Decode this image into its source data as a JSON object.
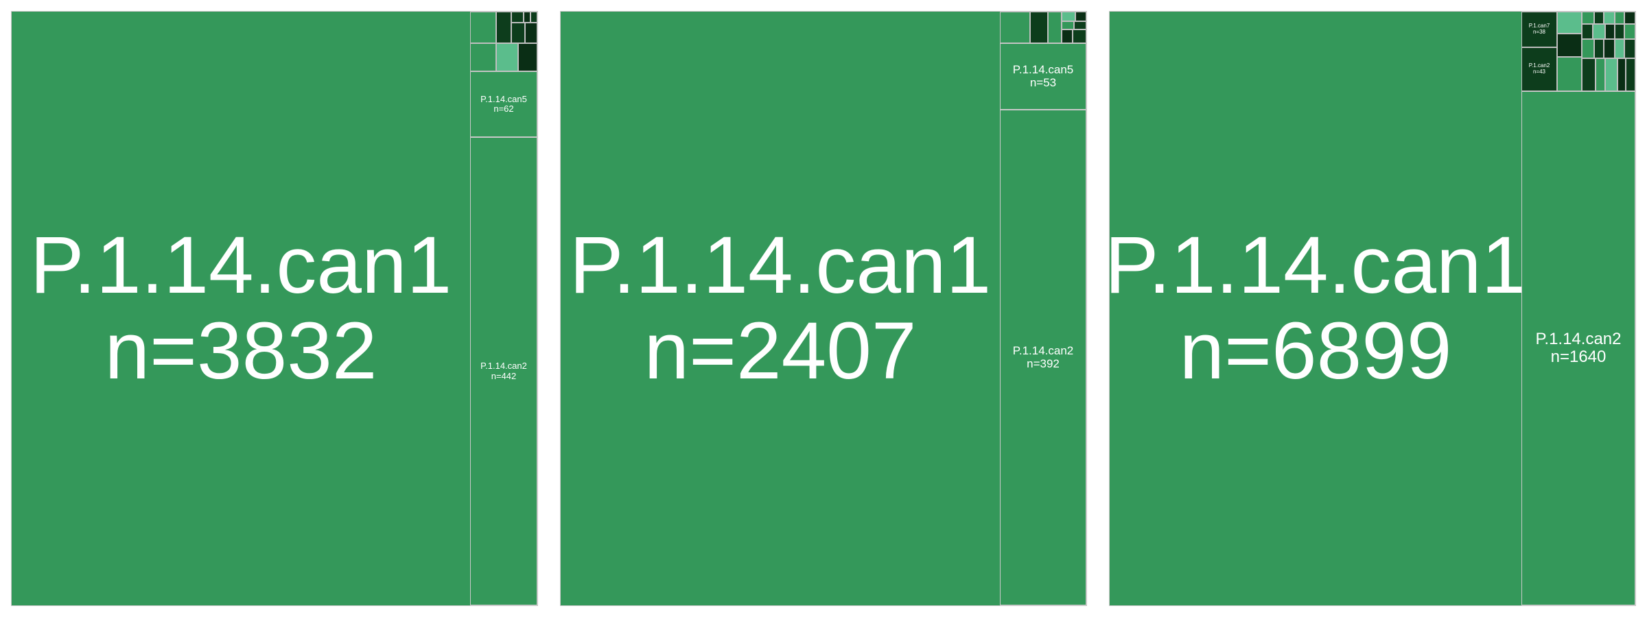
{
  "chart_data": [
    {
      "type": "treemap",
      "cells": [
        {
          "name": "P.1.14.can1",
          "n_label": "n=3832",
          "value": 3832
        },
        {
          "name": "P.1.14.can2",
          "n_label": "n=442",
          "value": 442
        },
        {
          "name": "P.1.14.can5",
          "n_label": "n=62",
          "value": 62
        }
      ]
    },
    {
      "type": "treemap",
      "cells": [
        {
          "name": "P.1.14.can1",
          "n_label": "n=2407",
          "value": 2407
        },
        {
          "name": "P.1.14.can2",
          "n_label": "n=392",
          "value": 392
        },
        {
          "name": "P.1.14.can5",
          "n_label": "n=53",
          "value": 53
        }
      ]
    },
    {
      "type": "treemap",
      "cells": [
        {
          "name": "P.1.14.can1",
          "n_label": "n=6899",
          "value": 6899
        },
        {
          "name": "P.1.14.can2",
          "n_label": "n=1640",
          "value": 1640
        },
        {
          "name": "P.1.can7",
          "n_label": "n=38",
          "value": 38
        },
        {
          "name": "P.1.can2",
          "n_label": "n=43",
          "value": 43
        }
      ]
    }
  ],
  "colors": {
    "main": "#34985a",
    "dark": "#0d3d1c",
    "darker": "#0a2e15",
    "light": "#5bbd8c",
    "border": "#c9c9c9"
  }
}
